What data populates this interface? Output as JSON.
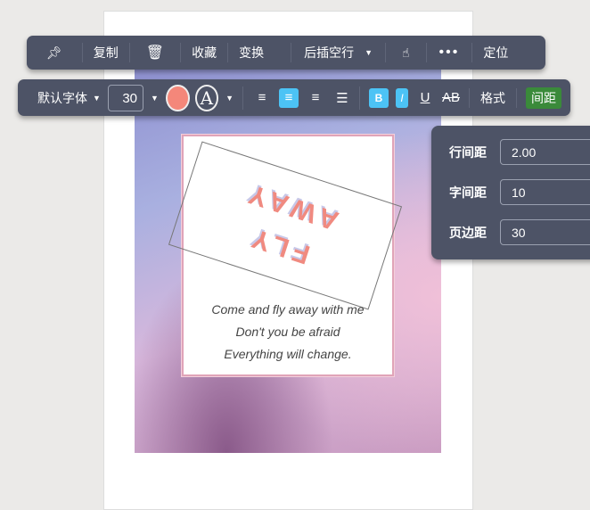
{
  "toolbar_top": {
    "pin_icon": "pin-icon",
    "copy": "复制",
    "delete_icon": "trash-icon",
    "favorite": "收藏",
    "transform": "变换",
    "insert_after": "后插空行",
    "touch_icon": "hand-pointer-icon",
    "more": "•••",
    "locate": "定位"
  },
  "toolbar_format": {
    "font": "默认字体",
    "font_size": "30",
    "text_color": "#f4877a",
    "outline_letter": "A",
    "bold": "B",
    "italic": "I",
    "underline": "U",
    "strike": "AB",
    "format": "格式",
    "spacing": "间距"
  },
  "spacing_panel": {
    "line_spacing_label": "行间距",
    "line_spacing": "2.00",
    "letter_spacing_label": "字间距",
    "letter_spacing": "10",
    "margin_label": "页边距",
    "margin": "30"
  },
  "canvas": {
    "title_line1": "FLY",
    "title_line2": "AWAY",
    "lyrics": [
      "Come and fly away with me",
      "Don't you be afraid",
      "Everything will change."
    ]
  }
}
